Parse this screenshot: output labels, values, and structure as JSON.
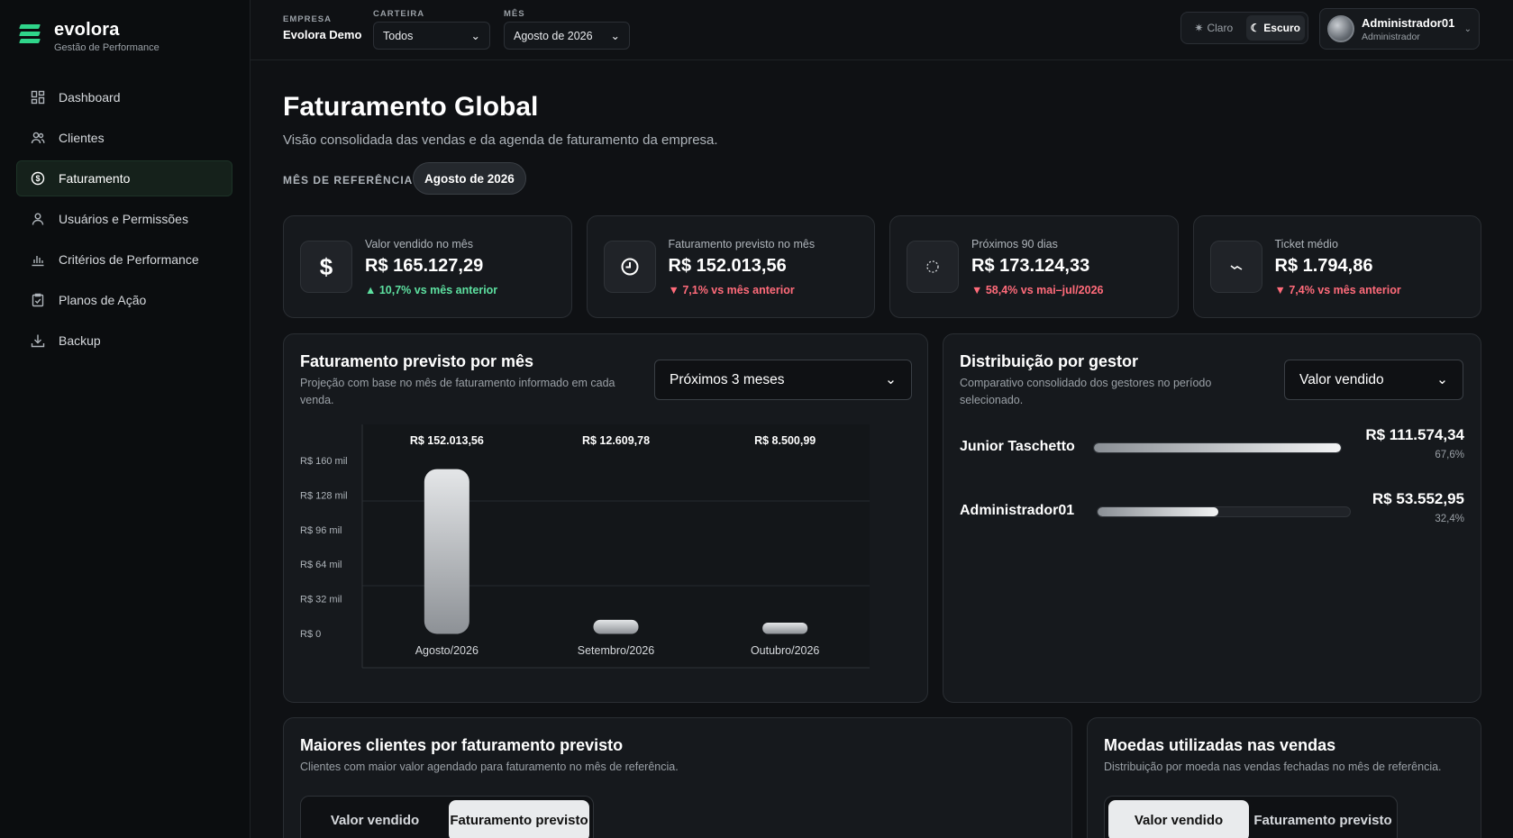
{
  "brand": {
    "name": "evolora",
    "tagline": "Gestão de Performance"
  },
  "sidebar": {
    "items": [
      {
        "label": "Dashboard",
        "icon": "dashboard-icon",
        "active": false
      },
      {
        "label": "Clientes",
        "icon": "users-icon",
        "active": false
      },
      {
        "label": "Faturamento",
        "icon": "dollar-circle-icon",
        "active": true
      },
      {
        "label": "Usuários e Permissões",
        "icon": "user-icon",
        "active": false
      },
      {
        "label": "Critérios de Performance",
        "icon": "bar-chart-icon",
        "active": false
      },
      {
        "label": "Planos de Ação",
        "icon": "clipboard-check-icon",
        "active": false
      },
      {
        "label": "Backup",
        "icon": "download-icon",
        "active": false
      }
    ]
  },
  "topbar": {
    "empresa_label": "EMPRESA",
    "empresa_value": "Evolora Demo",
    "carteira_label": "CARTEIRA",
    "carteira_value": "Todos",
    "mes_label": "MÊS",
    "mes_value": "Agosto de 2026",
    "theme_light": "Claro",
    "theme_dark": "Escuro",
    "user_name": "Administrador01",
    "user_role": "Administrador"
  },
  "page": {
    "title": "Faturamento Global",
    "subtitle": "Visão consolidada das vendas e da agenda de faturamento da empresa.",
    "ref_label": "MÊS DE REFERÊNCIA",
    "ref_value": "Agosto de 2026"
  },
  "kpis": [
    {
      "label": "Valor vendido no mês",
      "value": "R$ 165.127,29",
      "delta": "▲ 10,7% vs mês anterior",
      "trend": "up",
      "icon": "dollar-icon"
    },
    {
      "label": "Faturamento previsto no mês",
      "value": "R$ 152.013,56",
      "delta": "▼ 7,1% vs mês anterior",
      "trend": "down",
      "icon": "clock-icon"
    },
    {
      "label": "Próximos 90 dias",
      "value": "R$ 173.124,33",
      "delta": "▼ 58,4% vs mai–jul/2026",
      "trend": "down",
      "icon": "loading-circle-icon"
    },
    {
      "label": "Ticket médio",
      "value": "R$ 1.794,86",
      "delta": "▼ 7,4% vs mês anterior",
      "trend": "down",
      "icon": "trend-line-icon"
    }
  ],
  "forecast_card": {
    "title": "Faturamento previsto por mês",
    "subtitle": "Projeção com base no mês de faturamento informado em cada venda.",
    "select_value": "Próximos 3 meses"
  },
  "chart_data": {
    "type": "bar",
    "categories": [
      "Agosto/2026",
      "Setembro/2026",
      "Outubro/2026"
    ],
    "values": [
      152013.56,
      12609.78,
      8500.99
    ],
    "data_labels": [
      "R$ 152.013,56",
      "R$ 12.609,78",
      "R$ 8.500,99"
    ],
    "y_ticks": [
      "R$ 0",
      "R$ 32 mil",
      "R$ 64 mil",
      "R$ 96 mil",
      "R$ 128 mil",
      "R$ 160 mil"
    ],
    "y_tick_values": [
      0,
      32000,
      64000,
      96000,
      128000,
      160000
    ],
    "ylim": [
      0,
      160000
    ],
    "title": "",
    "xlabel": "",
    "ylabel": ""
  },
  "gestor_card": {
    "title": "Distribuição por gestor",
    "subtitle": "Comparativo consolidado dos gestores no período selecionado.",
    "select_value": "Valor vendido",
    "rows": [
      {
        "name": "Junior Taschetto",
        "value": "R$ 111.574,34",
        "pct": "67,6%",
        "share": 0.676
      },
      {
        "name": "Administrador01",
        "value": "R$ 53.552,95",
        "pct": "32,4%",
        "share": 0.324
      }
    ]
  },
  "clients_card": {
    "title": "Maiores clientes por faturamento previsto",
    "subtitle": "Clientes com maior valor agendado para faturamento no mês de referência.",
    "seg_a": "Valor vendido",
    "seg_b": "Faturamento previsto"
  },
  "currency_card": {
    "title": "Moedas utilizadas nas vendas",
    "subtitle": "Distribuição por moeda nas vendas fechadas no mês de referência.",
    "seg_a": "Valor vendido",
    "seg_b": "Faturamento previsto"
  }
}
